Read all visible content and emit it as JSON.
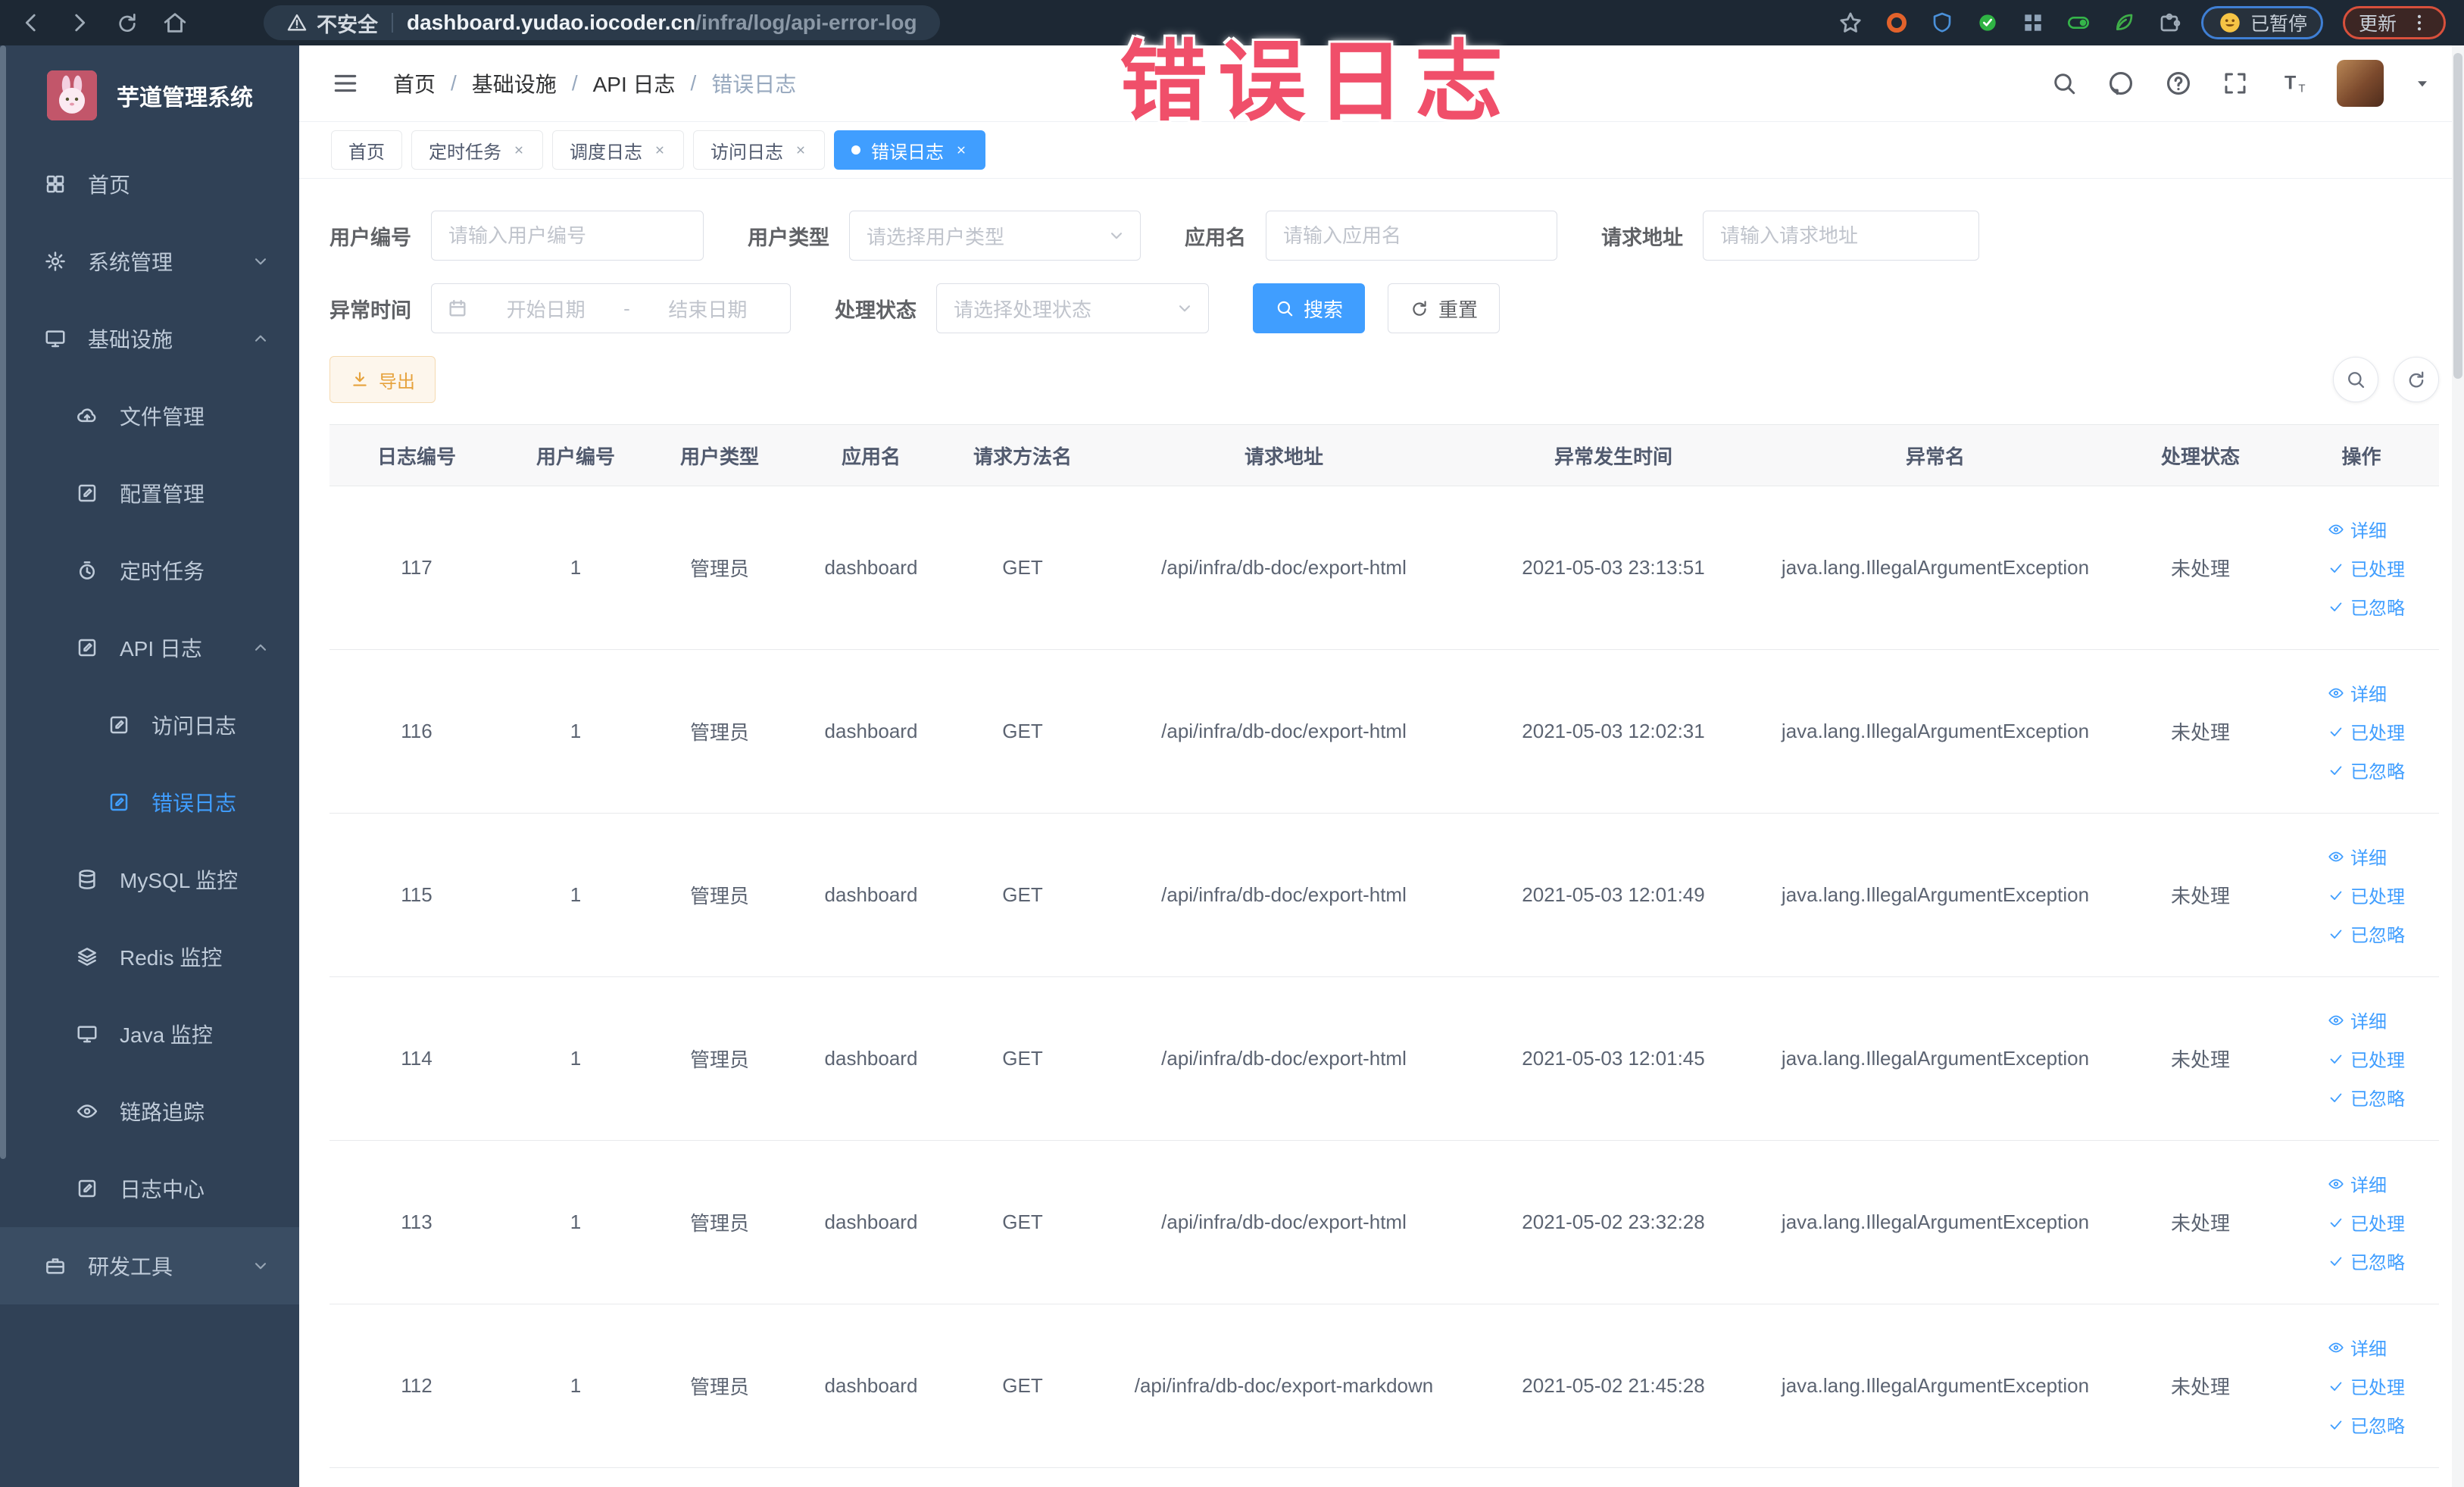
{
  "annotation": {
    "text": "错误日志"
  },
  "browser": {
    "security_label": "不安全",
    "url_host": "dashboard.yudao.iocoder.cn",
    "url_path": "/infra/log/api-error-log",
    "paused_label": "已暂停",
    "update_label": "更新",
    "extension_icons": [
      "orange-extension-icon",
      "shield-extension-icon",
      "green-v-extension-icon",
      "grid-extension-icon",
      "toggle-on-extension-icon",
      "leaf-extension-icon"
    ]
  },
  "sidebar": {
    "title": "芋道管理系统",
    "items": [
      {
        "label": "首页",
        "icon": "dashboard-icon",
        "level": 0
      },
      {
        "label": "系统管理",
        "icon": "gear-icon",
        "level": 0,
        "chevron": "down"
      },
      {
        "label": "基础设施",
        "icon": "infrastructure-icon",
        "level": 0,
        "chevron": "up"
      },
      {
        "label": "文件管理",
        "icon": "file-upload-icon",
        "level": 1
      },
      {
        "label": "配置管理",
        "icon": "config-icon",
        "level": 1
      },
      {
        "label": "定时任务",
        "icon": "timer-icon",
        "level": 1
      },
      {
        "label": "API 日志",
        "icon": "api-log-icon",
        "level": 1,
        "chevron": "up"
      },
      {
        "label": "访问日志",
        "icon": "access-log-icon",
        "level": 2
      },
      {
        "label": "错误日志",
        "icon": "error-log-icon",
        "level": 2,
        "active": true
      },
      {
        "label": "MySQL 监控",
        "icon": "mysql-icon",
        "level": 1
      },
      {
        "label": "Redis 监控",
        "icon": "redis-icon",
        "level": 1
      },
      {
        "label": "Java 监控",
        "icon": "java-icon",
        "level": 1
      },
      {
        "label": "链路追踪",
        "icon": "trace-icon",
        "level": 1
      },
      {
        "label": "日志中心",
        "icon": "log-center-icon",
        "level": 1
      },
      {
        "label": "研发工具",
        "icon": "devtool-icon",
        "level": 0,
        "chevron": "down",
        "highlight": true
      }
    ]
  },
  "header": {
    "breadcrumb": [
      "首页",
      "基础设施",
      "API 日志",
      "错误日志"
    ]
  },
  "tabs": [
    {
      "label": "首页",
      "closable": false,
      "active": false
    },
    {
      "label": "定时任务",
      "closable": true,
      "active": false
    },
    {
      "label": "调度日志",
      "closable": true,
      "active": false
    },
    {
      "label": "访问日志",
      "closable": true,
      "active": false
    },
    {
      "label": "错误日志",
      "closable": true,
      "active": true
    }
  ],
  "filters": {
    "user_id": {
      "label": "用户编号",
      "placeholder": "请输入用户编号"
    },
    "user_type": {
      "label": "用户类型",
      "placeholder": "请选择用户类型"
    },
    "app_name": {
      "label": "应用名",
      "placeholder": "请输入应用名"
    },
    "request_url": {
      "label": "请求地址",
      "placeholder": "请输入请求地址"
    },
    "exception_time": {
      "label": "异常时间",
      "start_placeholder": "开始日期",
      "separator": "-",
      "end_placeholder": "结束日期"
    },
    "process_status": {
      "label": "处理状态",
      "placeholder": "请选择处理状态"
    },
    "search_label": "搜索",
    "reset_label": "重置"
  },
  "toolbar": {
    "export_label": "导出"
  },
  "table": {
    "columns": [
      "日志编号",
      "用户编号",
      "用户类型",
      "应用名",
      "请求方法名",
      "请求地址",
      "异常发生时间",
      "异常名",
      "处理状态",
      "操作"
    ],
    "actions": [
      "详细",
      "已处理",
      "已忽略"
    ],
    "rows": [
      {
        "log_id": "117",
        "user_id": "1",
        "user_type": "管理员",
        "app_name": "dashboard",
        "method": "GET",
        "request_url": "/api/infra/db-doc/export-html",
        "time": "2021-05-03 23:13:51",
        "exception": "java.lang.IllegalArgumentException",
        "status": "未处理"
      },
      {
        "log_id": "116",
        "user_id": "1",
        "user_type": "管理员",
        "app_name": "dashboard",
        "method": "GET",
        "request_url": "/api/infra/db-doc/export-html",
        "time": "2021-05-03 12:02:31",
        "exception": "java.lang.IllegalArgumentException",
        "status": "未处理"
      },
      {
        "log_id": "115",
        "user_id": "1",
        "user_type": "管理员",
        "app_name": "dashboard",
        "method": "GET",
        "request_url": "/api/infra/db-doc/export-html",
        "time": "2021-05-03 12:01:49",
        "exception": "java.lang.IllegalArgumentException",
        "status": "未处理"
      },
      {
        "log_id": "114",
        "user_id": "1",
        "user_type": "管理员",
        "app_name": "dashboard",
        "method": "GET",
        "request_url": "/api/infra/db-doc/export-html",
        "time": "2021-05-03 12:01:45",
        "exception": "java.lang.IllegalArgumentException",
        "status": "未处理"
      },
      {
        "log_id": "113",
        "user_id": "1",
        "user_type": "管理员",
        "app_name": "dashboard",
        "method": "GET",
        "request_url": "/api/infra/db-doc/export-html",
        "time": "2021-05-02 23:32:28",
        "exception": "java.lang.IllegalArgumentException",
        "status": "未处理"
      },
      {
        "log_id": "112",
        "user_id": "1",
        "user_type": "管理员",
        "app_name": "dashboard",
        "method": "GET",
        "request_url": "/api/infra/db-doc/export-markdown",
        "time": "2021-05-02 21:45:28",
        "exception": "java.lang.IllegalArgumentException",
        "status": "未处理"
      }
    ]
  },
  "colors": {
    "accent": "#409eff",
    "warning": "#e6a23c",
    "annotation": "#f0506a",
    "sidebar_bg": "#304156"
  }
}
